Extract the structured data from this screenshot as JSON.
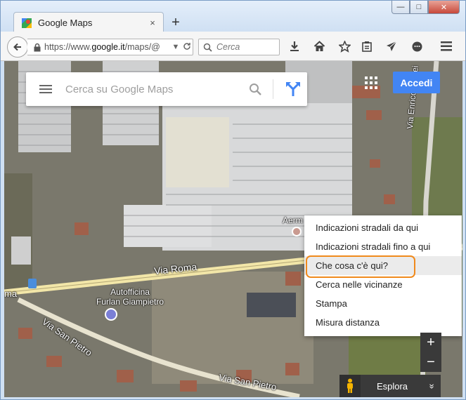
{
  "browser": {
    "tab_title": "Google Maps",
    "new_tab": "+",
    "tab_close": "×",
    "url_prefix": "https://www.",
    "url_domain": "google.it",
    "url_suffix": "/maps/@",
    "search_placeholder": "Cerca",
    "window_controls": {
      "minimize": "—",
      "maximize": "□",
      "close": "✕"
    }
  },
  "maps": {
    "search_placeholder": "Cerca su Google Maps",
    "signin_label": "Accedi",
    "context_menu": [
      "Indicazioni stradali da qui",
      "Indicazioni stradali fino a qui",
      "Che cosa c'è qui?",
      "Cerca nelle vicinanze",
      "Stampa",
      "Misura distanza"
    ],
    "zoom_in": "+",
    "zoom_out": "−",
    "explore_label": "Esplora",
    "explore_chevron": "»",
    "labels": {
      "via_roma": "Via Roma",
      "via_san_pietro_1": "Via San Pietro",
      "via_san_pietro_2": "Via San Pietro",
      "via_enrico_mattei": "Via Enrico Mattei",
      "poi_line1": "Autofficina",
      "poi_line2": "Furlan Giampietro",
      "aerm": "Aerm",
      "ma": "ma"
    }
  },
  "colors": {
    "accent": "#4285f4",
    "highlight": "#f08a1c"
  }
}
